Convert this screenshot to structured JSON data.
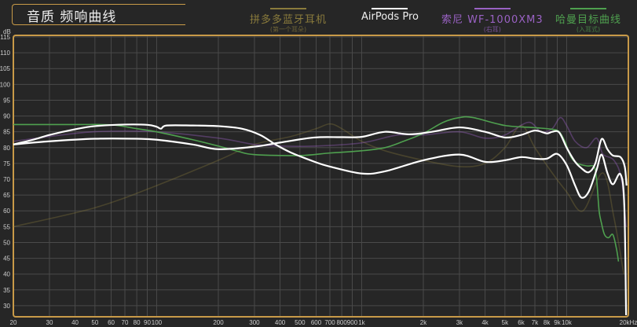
{
  "title": "音质 频响曲线",
  "legend": [
    {
      "name": "拼多多蓝牙耳机",
      "sub": "(第一个耳朵)",
      "color": "#8a7b3c"
    },
    {
      "name": "AirPods Pro",
      "sub": "",
      "color": "#ffffff"
    },
    {
      "name": "索尼 WF-1000XM3",
      "sub": "(右耳)",
      "color": "#9a62c4"
    },
    {
      "name": "哈曼目标曲线",
      "sub": "(入耳式)",
      "color": "#4fa04f"
    }
  ],
  "chart_data": {
    "type": "line",
    "title": "音质 频响曲线",
    "xlabel": "Hz",
    "ylabel": "dB",
    "xscale": "log",
    "xlim": [
      20,
      20000
    ],
    "ylim": [
      26.5,
      115.5
    ],
    "grid": true,
    "legend_position": "top",
    "x_ticks": [
      {
        "v": 20,
        "label": "20"
      },
      {
        "v": 30,
        "label": "30"
      },
      {
        "v": 40,
        "label": "40"
      },
      {
        "v": 50,
        "label": "50"
      },
      {
        "v": 60,
        "label": "60"
      },
      {
        "v": 70,
        "label": "70"
      },
      {
        "v": 80,
        "label": "80"
      },
      {
        "v": 90,
        "label": "90"
      },
      {
        "v": 100,
        "label": "100"
      },
      {
        "v": 200,
        "label": "200"
      },
      {
        "v": 300,
        "label": "300"
      },
      {
        "v": 400,
        "label": "400"
      },
      {
        "v": 500,
        "label": "500"
      },
      {
        "v": 600,
        "label": "600"
      },
      {
        "v": 700,
        "label": "700"
      },
      {
        "v": 800,
        "label": "800"
      },
      {
        "v": 900,
        "label": "900"
      },
      {
        "v": 1000,
        "label": "1k"
      },
      {
        "v": 2000,
        "label": "2k"
      },
      {
        "v": 3000,
        "label": "3k"
      },
      {
        "v": 4000,
        "label": "4k"
      },
      {
        "v": 5000,
        "label": "5k"
      },
      {
        "v": 6000,
        "label": "6k"
      },
      {
        "v": 7000,
        "label": "7k"
      },
      {
        "v": 8000,
        "label": "8k"
      },
      {
        "v": 9000,
        "label": "9k"
      },
      {
        "v": 10000,
        "label": "10k"
      },
      {
        "v": 20000,
        "label": "20kHz"
      }
    ],
    "y_ticks": [
      30,
      35,
      40,
      45,
      50,
      55,
      60,
      65,
      70,
      75,
      80,
      85,
      90,
      95,
      100,
      105,
      110,
      115
    ],
    "y_unit_label": "dB",
    "series": [
      {
        "name": "拼多多蓝牙耳机",
        "color": "#8a7b3c",
        "opacity": 0.35,
        "points": [
          [
            20,
            55
          ],
          [
            50,
            61
          ],
          [
            100,
            68
          ],
          [
            200,
            76
          ],
          [
            300,
            81
          ],
          [
            450,
            83.5
          ],
          [
            600,
            86
          ],
          [
            700,
            87.5
          ],
          [
            800,
            86
          ],
          [
            1000,
            82
          ],
          [
            1300,
            79
          ],
          [
            2000,
            76
          ],
          [
            3000,
            74
          ],
          [
            4000,
            75
          ],
          [
            5000,
            80
          ],
          [
            6000,
            87
          ],
          [
            7000,
            80
          ],
          [
            8500,
            72
          ],
          [
            10000,
            66
          ],
          [
            12000,
            60
          ],
          [
            15000,
            72
          ],
          [
            17000,
            58
          ],
          [
            19000,
            40
          ]
        ]
      },
      {
        "name": "索尼 WF-1000XM3",
        "color": "#9a62c4",
        "opacity": 0.4,
        "points": [
          [
            20,
            82
          ],
          [
            40,
            84.5
          ],
          [
            60,
            85.2
          ],
          [
            100,
            85
          ],
          [
            200,
            83
          ],
          [
            300,
            81
          ],
          [
            400,
            80.5
          ],
          [
            600,
            80.5
          ],
          [
            1000,
            81.5
          ],
          [
            1500,
            84
          ],
          [
            2000,
            84
          ],
          [
            3000,
            85
          ],
          [
            4000,
            83
          ],
          [
            5000,
            84
          ],
          [
            6500,
            88
          ],
          [
            7500,
            85
          ],
          [
            8500,
            86
          ],
          [
            9300,
            89.5
          ],
          [
            10000,
            87
          ],
          [
            11000,
            82
          ],
          [
            12500,
            80
          ],
          [
            14000,
            83
          ],
          [
            15000,
            78
          ],
          [
            17000,
            76
          ],
          [
            18500,
            70
          ],
          [
            19500,
            55
          ]
        ]
      },
      {
        "name": "哈曼目标曲线",
        "color": "#4fa04f",
        "opacity": 1,
        "points": [
          [
            20,
            87.3
          ],
          [
            40,
            87.3
          ],
          [
            60,
            87.2
          ],
          [
            80,
            86
          ],
          [
            100,
            85
          ],
          [
            150,
            82.5
          ],
          [
            200,
            80.5
          ],
          [
            250,
            78.8
          ],
          [
            300,
            77.8
          ],
          [
            500,
            77.5
          ],
          [
            700,
            78.3
          ],
          [
            1000,
            79
          ],
          [
            1300,
            80
          ],
          [
            1600,
            82
          ],
          [
            2000,
            84.5
          ],
          [
            2500,
            88
          ],
          [
            3000,
            89.5
          ],
          [
            3500,
            89.5
          ],
          [
            5000,
            87
          ],
          [
            7000,
            86.3
          ],
          [
            8500,
            85.8
          ],
          [
            9200,
            85
          ],
          [
            9800,
            82
          ],
          [
            10500,
            77
          ],
          [
            11300,
            75
          ],
          [
            12600,
            74.2
          ],
          [
            13600,
            74
          ],
          [
            14000,
            70
          ],
          [
            14400,
            60
          ],
          [
            14800,
            56
          ],
          [
            15300,
            52.5
          ],
          [
            16000,
            51.5
          ],
          [
            16800,
            52.5
          ],
          [
            17500,
            48
          ],
          [
            17900,
            44
          ]
        ]
      },
      {
        "name": "AirPods Pro",
        "color": "#ffffff",
        "opacity": 1,
        "points": [
          [
            20,
            81
          ],
          [
            25,
            82.5
          ],
          [
            30,
            84
          ],
          [
            40,
            85.8
          ],
          [
            50,
            86.8
          ],
          [
            70,
            87.3
          ],
          [
            90,
            87.2
          ],
          [
            100,
            86.6
          ],
          [
            105,
            86
          ],
          [
            112,
            87
          ],
          [
            150,
            87
          ],
          [
            200,
            86.8
          ],
          [
            260,
            86
          ],
          [
            320,
            84
          ],
          [
            380,
            81
          ],
          [
            450,
            78.5
          ],
          [
            590,
            75.5
          ],
          [
            700,
            74
          ],
          [
            1000,
            71.8
          ],
          [
            1300,
            72.5
          ],
          [
            2000,
            76
          ],
          [
            3000,
            77.8
          ],
          [
            4000,
            75.5
          ],
          [
            5000,
            76
          ],
          [
            6000,
            77
          ],
          [
            7000,
            76.5
          ],
          [
            8000,
            76.5
          ],
          [
            9000,
            78
          ],
          [
            10000,
            74.5
          ],
          [
            11000,
            68
          ],
          [
            11800,
            64.2
          ],
          [
            12800,
            66
          ],
          [
            14000,
            73
          ],
          [
            14800,
            77.8
          ],
          [
            15800,
            72
          ],
          [
            16800,
            68.4
          ],
          [
            18300,
            71.6
          ],
          [
            19100,
            62
          ],
          [
            19500,
            27
          ]
        ]
      },
      {
        "name": "AirPods Pro",
        "color": "#ffffff",
        "opacity": 1,
        "points": [
          [
            20,
            81
          ],
          [
            30,
            82
          ],
          [
            50,
            82.8
          ],
          [
            80,
            82.8
          ],
          [
            100,
            82.5
          ],
          [
            150,
            81
          ],
          [
            200,
            79.5
          ],
          [
            300,
            80.3
          ],
          [
            400,
            81.6
          ],
          [
            586,
            83.2
          ],
          [
            800,
            83.3
          ],
          [
            1000,
            83.4
          ],
          [
            1300,
            85
          ],
          [
            1700,
            84.2
          ],
          [
            2200,
            85
          ],
          [
            3000,
            86.4
          ],
          [
            4000,
            85
          ],
          [
            5000,
            83.2
          ],
          [
            6000,
            84
          ],
          [
            7000,
            85.4
          ],
          [
            8000,
            84.5
          ],
          [
            8500,
            85
          ],
          [
            9200,
            84.8
          ],
          [
            10000,
            80
          ],
          [
            11000,
            75.5
          ],
          [
            11800,
            73.5
          ],
          [
            12800,
            72.2
          ],
          [
            13800,
            75
          ],
          [
            14800,
            82.7
          ],
          [
            15800,
            79.5
          ],
          [
            16800,
            77.5
          ],
          [
            18300,
            77
          ],
          [
            19200,
            74
          ],
          [
            19600,
            68
          ]
        ]
      }
    ]
  }
}
